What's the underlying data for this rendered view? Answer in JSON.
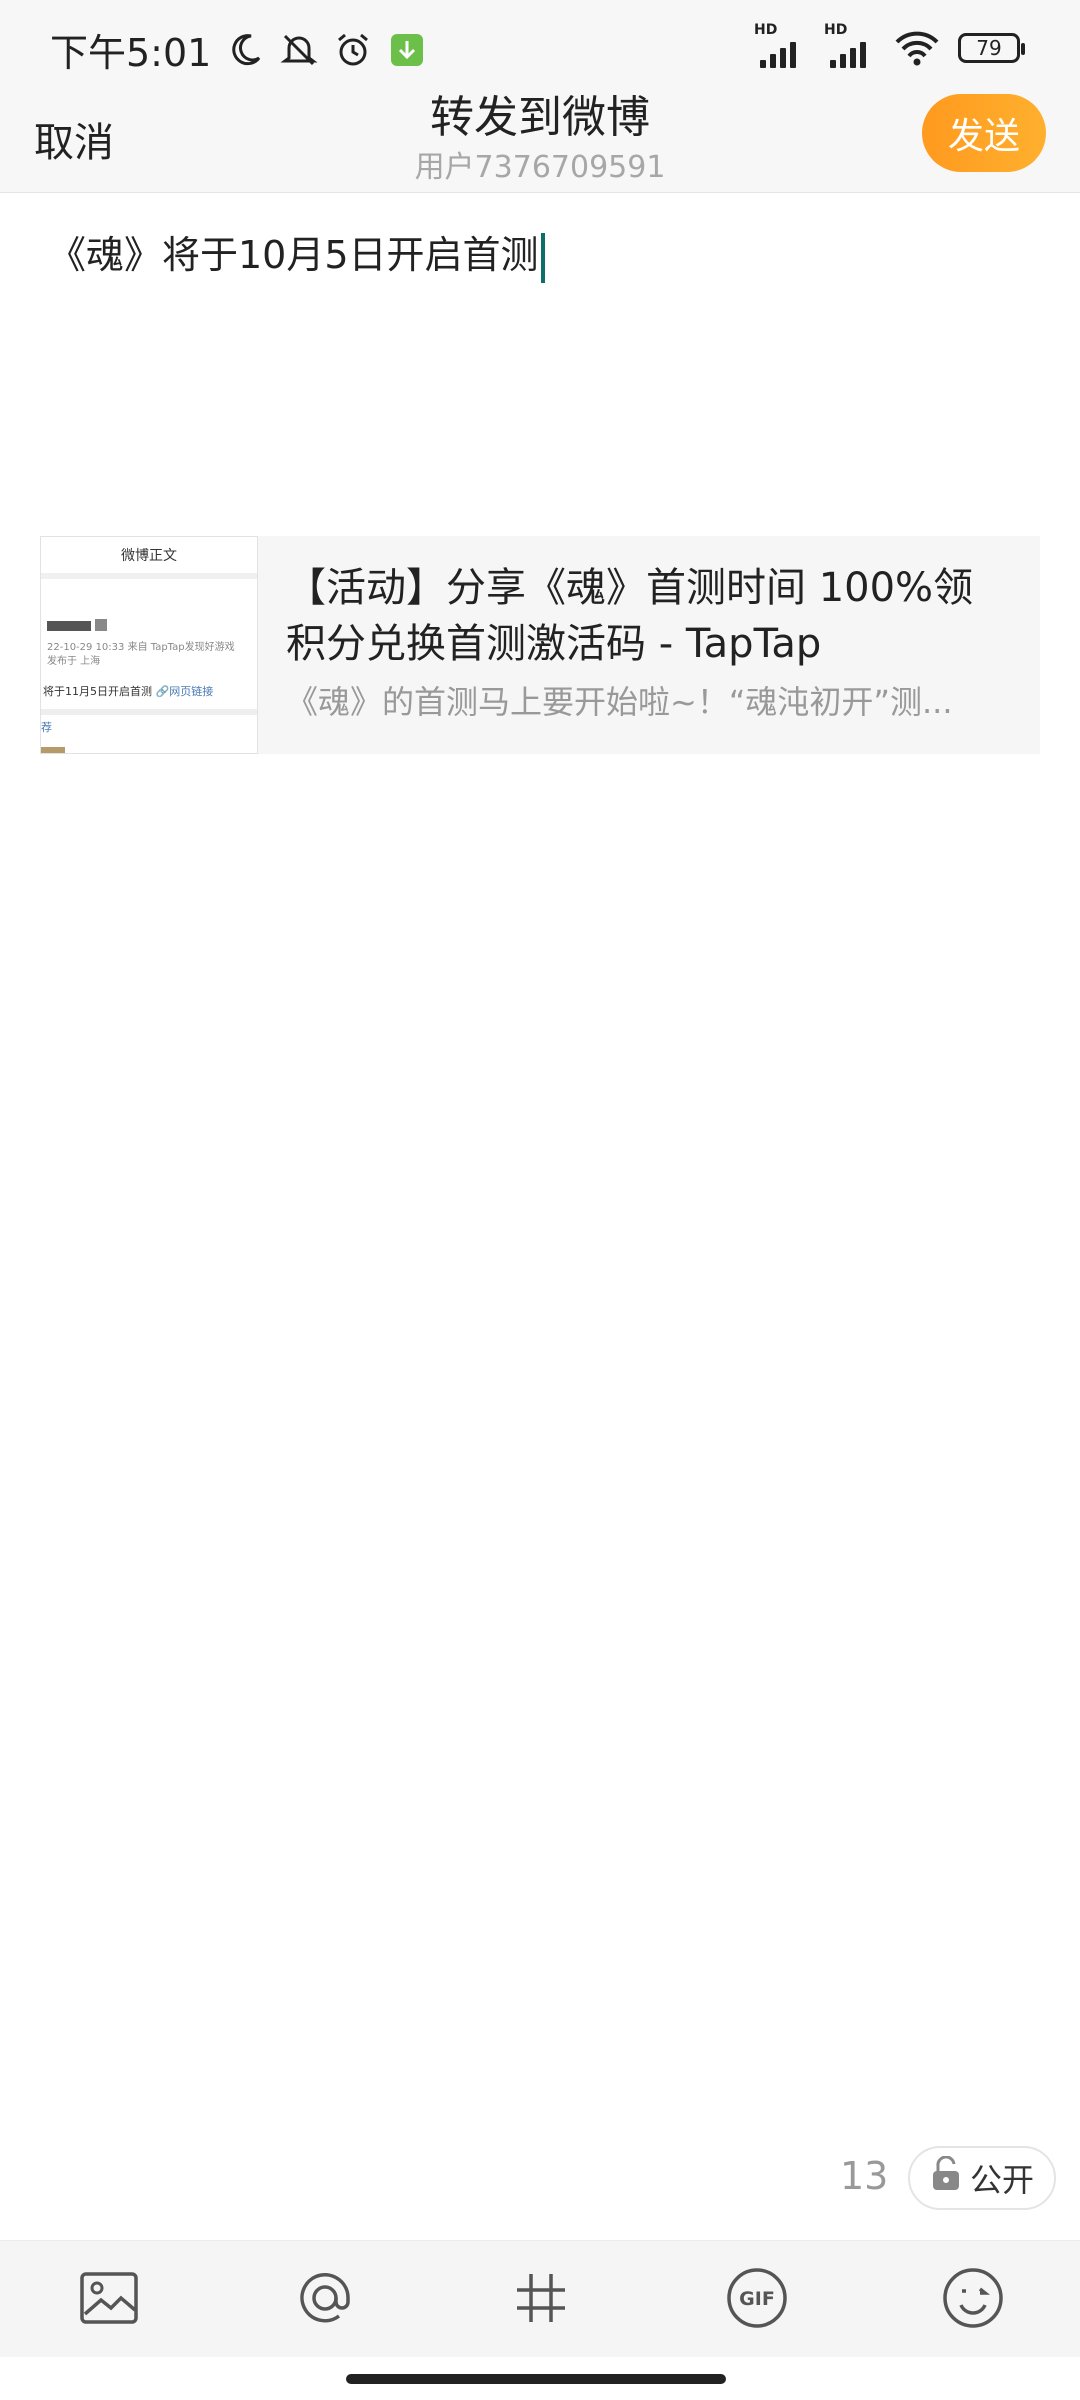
{
  "status_bar": {
    "time": "下午5:01",
    "battery": "79",
    "signal_hd_1": "HD",
    "signal_hd_2": "HD"
  },
  "header": {
    "cancel_label": "取消",
    "title": "转发到微博",
    "subtitle": "用户7376709591",
    "send_label": "发送"
  },
  "compose": {
    "text": "《魂》将于10月5日开启首测"
  },
  "link_card": {
    "thumb_title": "微博正文",
    "thumb_meta_1": "22-10-29 10:33 来自 TapTap发现好游戏",
    "thumb_meta_2": "发布于 上海",
    "thumb_line": "将于11月5日开启首测",
    "thumb_link": "网页链接",
    "thumb_tag": "荐",
    "title": "【活动】分享《魂》首测时间 100%领积分兑换首测激活码 - TapTap",
    "description": "《魂》的首测马上要开始啦~！“魂沌初开”测..."
  },
  "footer": {
    "char_count": "13",
    "visibility_label": "公开"
  },
  "toolbar": {
    "items": [
      "image-icon",
      "at-icon",
      "hashtag-icon",
      "gif-icon",
      "emoji-icon"
    ],
    "gif_label": "GIF"
  },
  "colors": {
    "accent": "#ff9f22",
    "caret": "#0e6e6a",
    "muted": "#999999"
  }
}
